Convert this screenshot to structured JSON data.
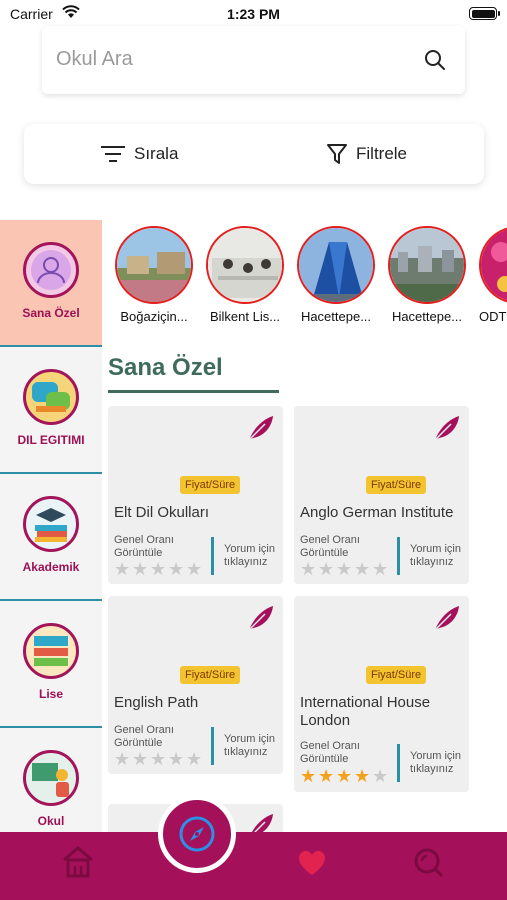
{
  "status_bar": {
    "carrier": "Carrier",
    "time": "1:23 PM"
  },
  "search": {
    "placeholder": "Okul Ara",
    "value": ""
  },
  "toolbar": {
    "sort_label": "Sırala",
    "filter_label": "Filtrele"
  },
  "sidebar": {
    "items": [
      {
        "label": "Sana Özel",
        "icon": "user-icon",
        "active": true
      },
      {
        "label": "DIL EGITIMI",
        "icon": "chat-bubbles-icon",
        "active": false
      },
      {
        "label": "Akademik",
        "icon": "books-icon",
        "active": false
      },
      {
        "label": "Lise",
        "icon": "bookshelf-icon",
        "active": false
      },
      {
        "label": "Okul",
        "icon": "teacher-icon",
        "active": false
      }
    ]
  },
  "stories": [
    {
      "label": "Boğaziçin...",
      "icon": "campus-photo"
    },
    {
      "label": "Bilkent Lis...",
      "icon": "classroom-photo"
    },
    {
      "label": "Hacettepe...",
      "icon": "building-photo"
    },
    {
      "label": "Hacettepe...",
      "icon": "city-photo"
    },
    {
      "label": "ODT",
      "icon": "flowers-photo"
    }
  ],
  "section": {
    "title": "Sana Özel"
  },
  "cards": [
    {
      "name": "Elt Dil Okulları",
      "badge": "Fiyat/Süre",
      "rating_label": "Genel Oranı Görüntüle",
      "review_label": "Yorum için tıklayınız",
      "rating": 0
    },
    {
      "name": "Anglo German Institute",
      "badge": "Fiyat/Süre",
      "rating_label": "Genel Oranı Görüntüle",
      "review_label": "Yorum için tıklayınız",
      "rating": 0
    },
    {
      "name": "English Path",
      "badge": "Fiyat/Süre",
      "rating_label": "Genel Oranı Görüntüle",
      "review_label": "Yorum için tıklayınız",
      "rating": 0
    },
    {
      "name": "International House London",
      "badge": "Fiyat/Süre",
      "rating_label": "Genel Oranı Görüntüle",
      "review_label": "Yorum için tıklayınız",
      "rating": 4
    }
  ],
  "tab_bar": {
    "tabs": [
      {
        "icon": "home-icon"
      },
      {
        "icon": "compass-icon"
      },
      {
        "icon": "heart-icon"
      },
      {
        "icon": "search-icon"
      }
    ]
  },
  "colors": {
    "brand": "#a4115a",
    "accent": "#2c8fa6",
    "badge": "#f4c330",
    "section_title": "#3f6b5c",
    "active_category": "#fbc5b4"
  }
}
